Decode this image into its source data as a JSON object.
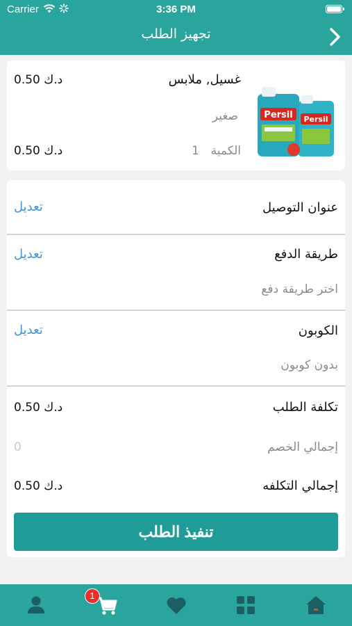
{
  "status_bar": {
    "carrier": "Carrier",
    "time": "3:36 PM"
  },
  "header": {
    "title": "تجهيز الطلب"
  },
  "product": {
    "name": "غسيل, ملابس",
    "price": "0.50 د.ك",
    "size": "صغير",
    "quantity_label": "الكمية",
    "quantity": "1",
    "total": "0.50 د.ك",
    "image_alt": "Persil"
  },
  "delivery": {
    "title": "عنوان التوصيل",
    "edit_label": "تعديل"
  },
  "payment": {
    "title": "طريقة الدفع",
    "edit_label": "تعديل",
    "value": "اختر طريقة دفع"
  },
  "coupon": {
    "title": "الكوبون",
    "edit_label": "تعديل",
    "value": "بدون كوبون"
  },
  "summary": {
    "order_cost_label": "تكلفة الطلب",
    "order_cost": "0.50 د.ك",
    "discount_label": "إجمالي الخصم",
    "discount": "0",
    "total_label": "إجمالي التكلفه",
    "total": "0.50 د.ك"
  },
  "submit": {
    "label": "تنفيذ الطلب"
  },
  "tabbar": {
    "items": [
      {
        "name": "profile",
        "icon": "person-icon"
      },
      {
        "name": "cart",
        "icon": "cart-icon",
        "badge": "1"
      },
      {
        "name": "favorites",
        "icon": "heart-icon"
      },
      {
        "name": "categories",
        "icon": "grid-icon"
      },
      {
        "name": "home",
        "icon": "home-icon"
      }
    ]
  },
  "colors": {
    "primary": "#2aa59e",
    "button": "#1f9c98",
    "link": "#3f96d8",
    "badge": "#e8312f"
  }
}
